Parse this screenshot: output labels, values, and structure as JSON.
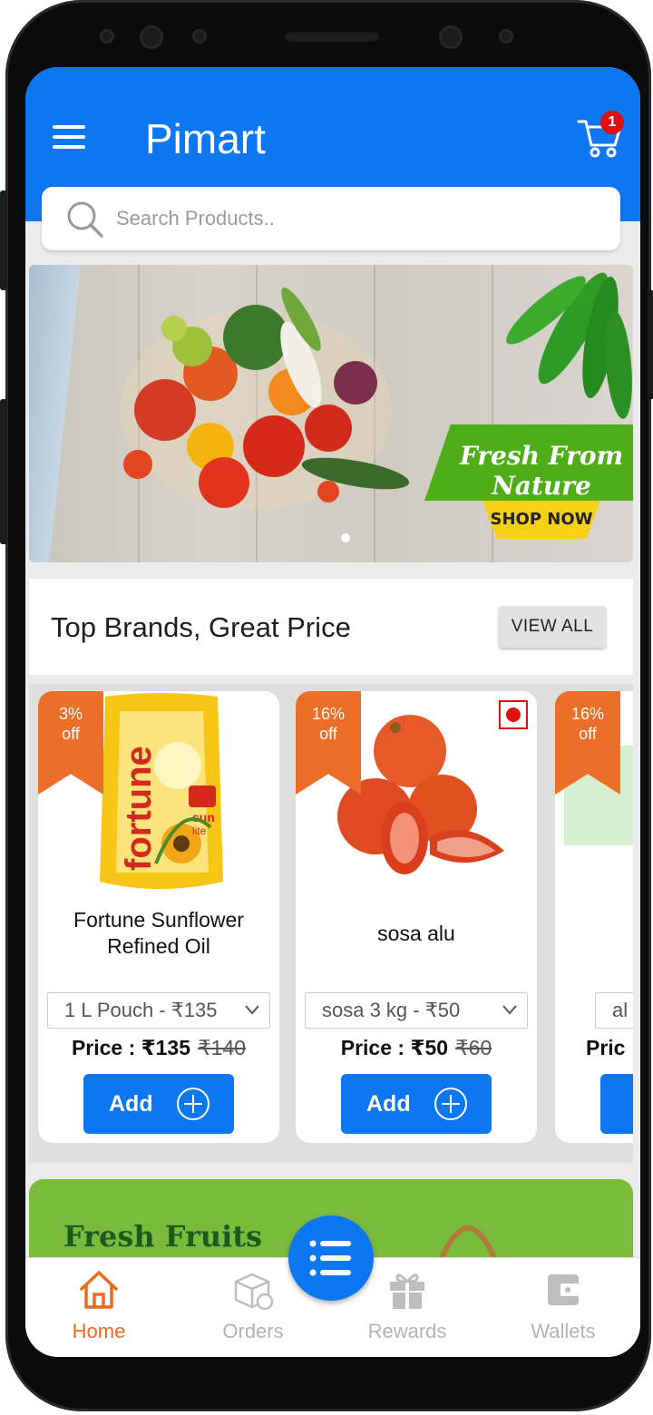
{
  "app": {
    "title": "Pimart",
    "cart_count": "1"
  },
  "search": {
    "placeholder": "Search Products.."
  },
  "banner": {
    "tagline": "Fresh From Nature",
    "cta": "SHOP NOW"
  },
  "section": {
    "title": "Top Brands, Great Price",
    "view_all": "VIEW ALL"
  },
  "products": [
    {
      "discount_pct": "3%",
      "discount_word": "off",
      "name": "Fortune Sunflower Refined Oil",
      "variant": "1 L Pouch - ₹135",
      "price": "Price : ₹135",
      "mrp": "₹140",
      "add": "Add"
    },
    {
      "discount_pct": "16%",
      "discount_word": "off",
      "name": "sosa alu",
      "variant": "sosa 3 kg - ₹50",
      "price": "Price : ₹50",
      "mrp": "₹60",
      "add": "Add"
    },
    {
      "discount_pct": "16%",
      "discount_word": "off",
      "variant": "al",
      "price": "Pric"
    }
  ],
  "promo": {
    "title": "Fresh Fruits"
  },
  "nav": [
    {
      "label": "Home",
      "icon": "home-icon",
      "active": true
    },
    {
      "label": "Orders",
      "icon": "orders-icon"
    },
    {
      "label": "Rewards",
      "icon": "gift-icon"
    },
    {
      "label": "Wallets",
      "icon": "wallet-icon"
    }
  ],
  "colors": {
    "primary": "#0d77f2",
    "accent": "#ea6a1f",
    "badge": "#e01010",
    "promo": "#7bbb3c"
  }
}
